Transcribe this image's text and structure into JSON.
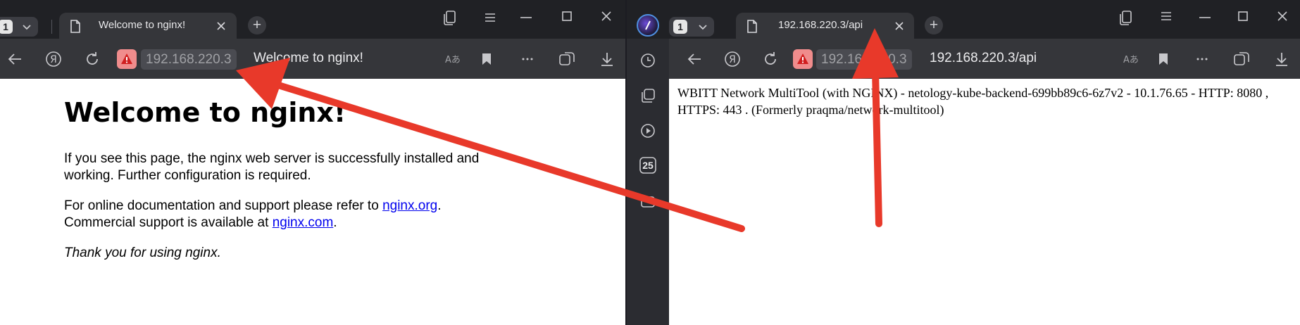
{
  "left_window": {
    "tab_count": "1",
    "tab_title": "Welcome to nginx!",
    "address_host": "192.168.220.3",
    "page_title": "Welcome to nginx!",
    "page": {
      "heading": "Welcome to nginx!",
      "para1": "If you see this page, the nginx web server is successfully installed and working. Further configuration is required.",
      "para2_text": "For online documentation and support please refer to ",
      "para2_link": "nginx.org",
      "para2_end": ".",
      "para3_text": "Commercial support is available at ",
      "para3_link": "nginx.com",
      "para3_end": ".",
      "thanks": "Thank you for using nginx."
    }
  },
  "right_window": {
    "tab_count": "1",
    "tab_title": "192.168.220.3/api",
    "address_host": "192.168.220.3",
    "page_title": "192.168.220.3/api",
    "sidebar_calendar_day": "25",
    "page_text": "WBITT Network MultiTool (with NGINX) - netology-kube-backend-699bb89c6-6z7v2 - 10.1.76.65 - HTTP: 8080 , HTTPS: 443 . (Formerly praqma/network-multitool)"
  },
  "icons": [
    "tab-list-icon",
    "menu-icon",
    "minimize-icon",
    "maximize-icon",
    "close-icon",
    "back-icon",
    "yandex-icon",
    "reload-icon",
    "warning-icon",
    "translate-icon",
    "bookmark-icon",
    "more-icon",
    "collections-icon",
    "download-icon",
    "history-icon",
    "tabs-icon",
    "video-icon",
    "calendar-icon",
    "alice-icon",
    "page-icon",
    "plus-icon"
  ],
  "colors": {
    "tab_bar": "#202125",
    "toolbar": "#35363a",
    "security_badge": "#f08c8c",
    "annotation_arrow": "#e8392a",
    "link": "#0000ee"
  }
}
